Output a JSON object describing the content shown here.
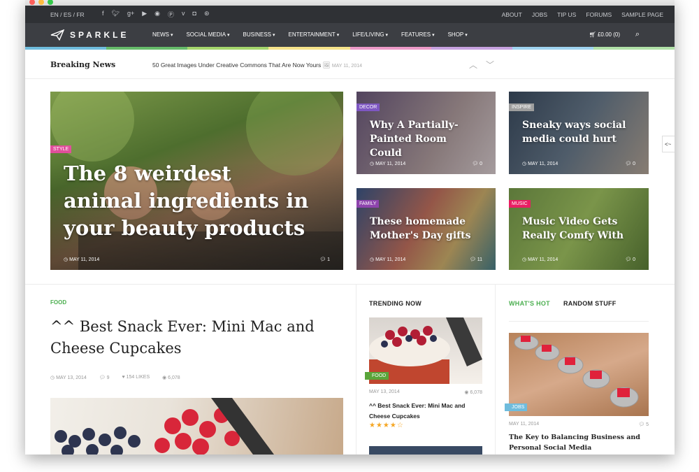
{
  "languages": "EN / ES / FR",
  "social_icons": [
    "facebook-icon",
    "twitter-icon",
    "googleplus-icon",
    "youtube-icon",
    "rss-icon",
    "pinterest-icon",
    "vimeo-icon",
    "instagram-icon",
    "dribbble-icon"
  ],
  "top_links": [
    "ABOUT",
    "JOBS",
    "TIP US",
    "FORUMS",
    "SAMPLE PAGE"
  ],
  "brand": "SPARKLE",
  "nav": [
    "NEWS",
    "SOCIAL MEDIA",
    "BUSINESS",
    "ENTERTAINMENT",
    "LIFE/LIVING",
    "FEATURES",
    "SHOP"
  ],
  "cart_label": "£0.00 (0)",
  "rainbow_colors": [
    "#6fbcdd",
    "#66bb6a",
    "#a5d66c",
    "#f6e38a",
    "#ec9ac8",
    "#c7a2e0",
    "#9fd3f0",
    "#b0e0a8"
  ],
  "breaking": {
    "label": "Breaking News",
    "headline": "50 Great Images Under Creative Commons That Are Now Yours",
    "date": "MAY 11, 2014"
  },
  "side_tab": "<~",
  "featured": {
    "tag": "STYLE",
    "tag_color": "#e04f9b",
    "title": "The 8 weirdest animal ingredients in your beauty products",
    "date": "MAY 11, 2014",
    "comments": "1"
  },
  "cards": [
    {
      "tag": "DECOR",
      "tag_color": "#7e57c2",
      "title": "Why A Partially-Painted Room Could",
      "date": "MAY 11, 2014",
      "comments": "0"
    },
    {
      "tag": "INSPIRE",
      "tag_color": "#9e9e9e",
      "title": "Sneaky ways social media could hurt",
      "date": "MAY 11, 2014",
      "comments": "0"
    },
    {
      "tag": "FAMILY",
      "tag_color": "#8e44ad",
      "title": "These homemade Mother's Day gifts",
      "date": "MAY 11, 2014",
      "comments": "11"
    },
    {
      "tag": "MUSIC",
      "tag_color": "#e91e63",
      "title": "Music Video Gets Really Comfy With",
      "date": "MAY 11, 2014",
      "comments": "0"
    }
  ],
  "post": {
    "tag": "FOOD",
    "title": "^^ Best Snack Ever: Mini Mac and Cheese Cupcakes",
    "date": "MAY 13, 2014",
    "comments": "9",
    "likes": "154 LIKES",
    "views": "6,078"
  },
  "trending": {
    "heading": "TRENDING NOW",
    "tag": "FOOD",
    "date": "MAY 13, 2014",
    "views": "6,078",
    "title": "^^ Best Snack Ever: Mini Mac and Cheese Cupcakes",
    "rating": "★★★★☆"
  },
  "whats_hot": {
    "tab_active": "WHAT'S HOT",
    "tab_other": "RANDOM STUFF",
    "tag": "JOBS",
    "date": "MAY 11, 2014",
    "comments": "5",
    "title": "The Key to Balancing Business and Personal Social Media"
  }
}
